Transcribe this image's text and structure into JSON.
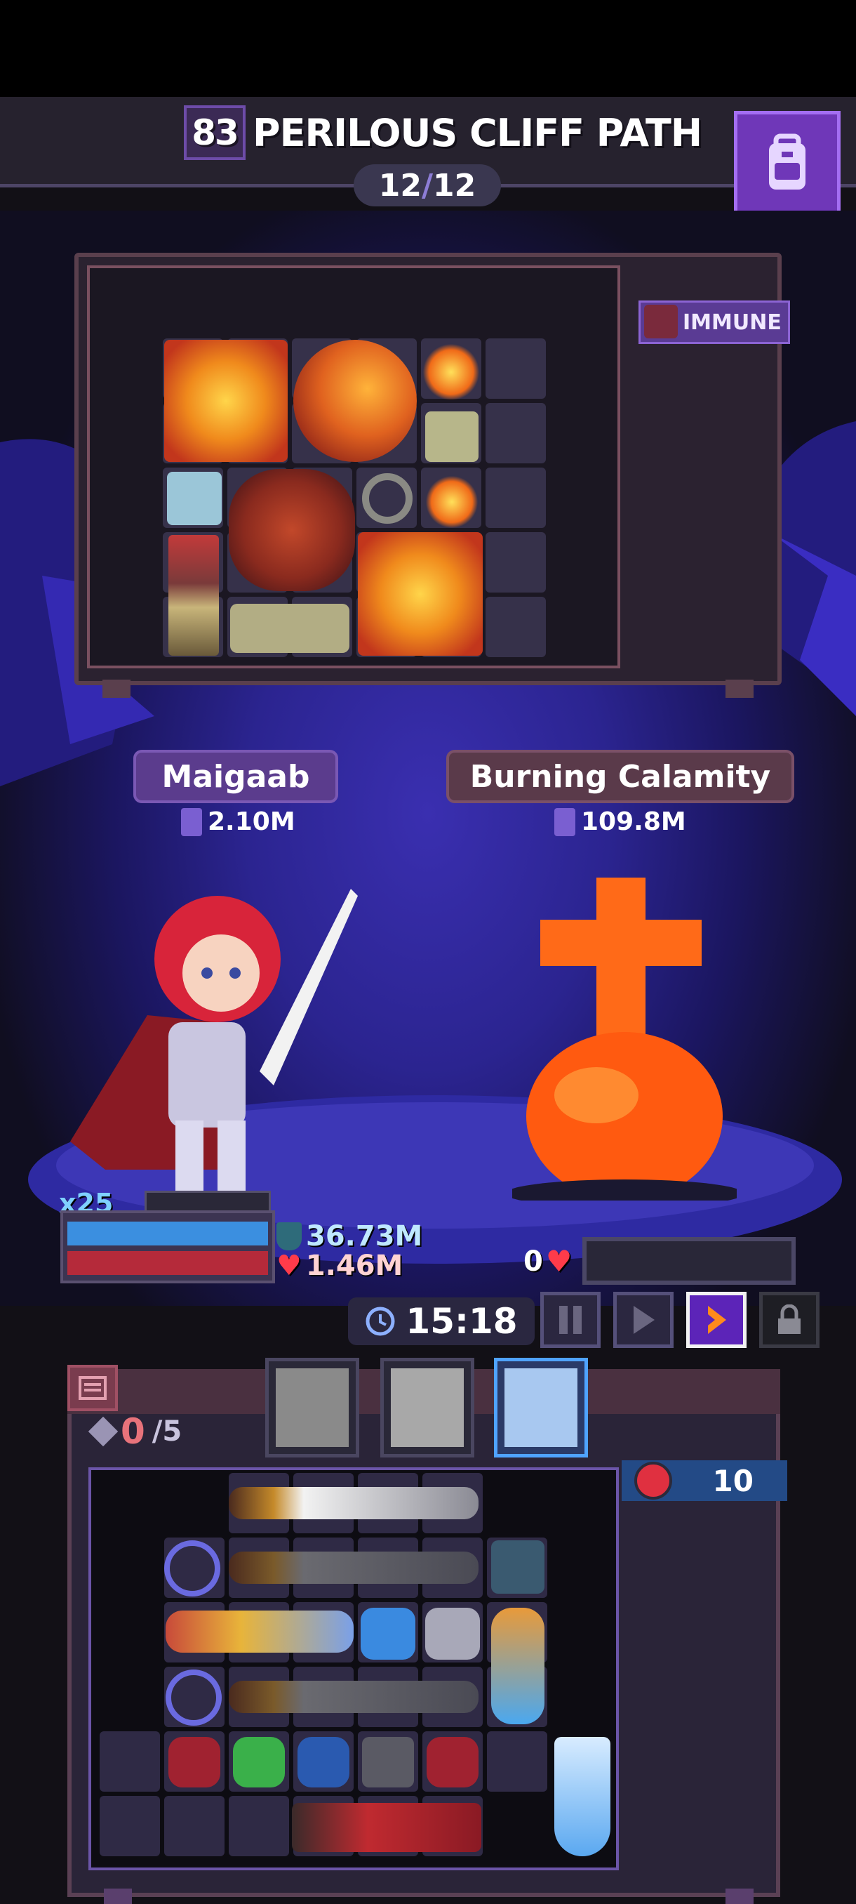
{
  "header": {
    "level": "83",
    "stage_title": "PERILOUS CLIFF PATH",
    "stage_current": "12",
    "stage_total": "12",
    "backpack_icon": "backpack-icon"
  },
  "enemy": {
    "status_label": "IMMUNE",
    "name": "Burning Calamity",
    "power": "109.8M",
    "hp": "0"
  },
  "hero": {
    "name": "Maigaab",
    "power": "2.10M",
    "multiplier": "x25",
    "shield": "36.73M",
    "hp": "1.46M"
  },
  "controls": {
    "timer": "15:18",
    "buttons": [
      "pause-button",
      "play-button",
      "fast-forward-button",
      "lock-button"
    ]
  },
  "inventory": {
    "gems_current": "0",
    "gems_max": "/5",
    "opponent_count": "10"
  },
  "colors": {
    "accent": "#6f37b8",
    "shield": "#3b8fe0",
    "health": "#b52a3a",
    "selected_tab": "#4fa3ff"
  }
}
